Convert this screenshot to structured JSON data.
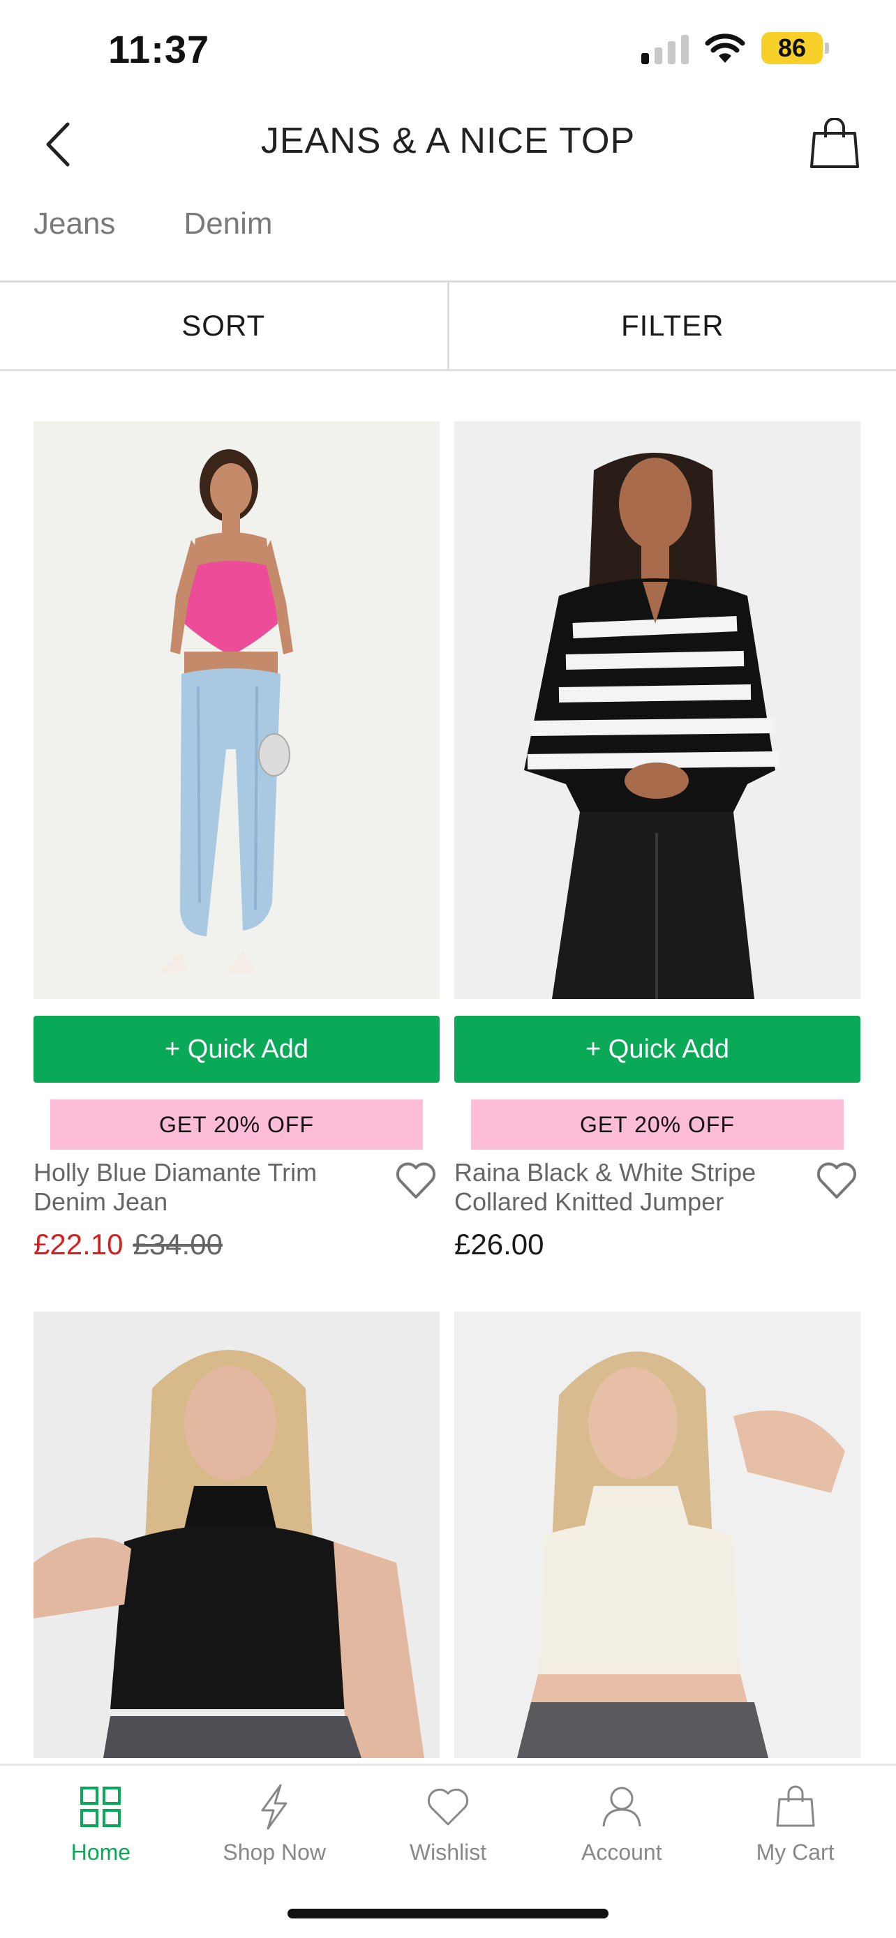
{
  "status_bar": {
    "time": "11:37",
    "battery": "86"
  },
  "header": {
    "title": "JEANS & A NICE TOP",
    "back_icon": "chevron-left-icon",
    "bag_icon": "shopping-bag-icon"
  },
  "categories": [
    {
      "label": "Jeans"
    },
    {
      "label": "Denim"
    }
  ],
  "toolbar": {
    "sort_label": "SORT",
    "filter_label": "FILTER"
  },
  "products": [
    {
      "name": "Holly Blue Diamante Trim Denim Jean",
      "price": "£22.10",
      "was_price": "£34.00",
      "quick_add": "+ Quick Add",
      "promo": "GET 20% OFF"
    },
    {
      "name": "Raina Black & White Stripe Collared Knitted Jumper",
      "price": "£26.00",
      "quick_add": "+ Quick Add",
      "promo": "GET 20% OFF"
    },
    {
      "name": "",
      "price": ""
    },
    {
      "name": "",
      "price": ""
    }
  ],
  "bottom_nav": [
    {
      "label": "Home",
      "icon": "grid-icon",
      "active": true
    },
    {
      "label": "Shop Now",
      "icon": "lightning-icon",
      "active": false
    },
    {
      "label": "Wishlist",
      "icon": "heart-icon",
      "active": false
    },
    {
      "label": "Account",
      "icon": "user-icon",
      "active": false
    },
    {
      "label": "My Cart",
      "icon": "shopping-bag-icon",
      "active": false
    }
  ],
  "colors": {
    "accent_green": "#0aa957",
    "promo_pink": "#fdbcd8",
    "sale_red": "#d61f1f"
  }
}
